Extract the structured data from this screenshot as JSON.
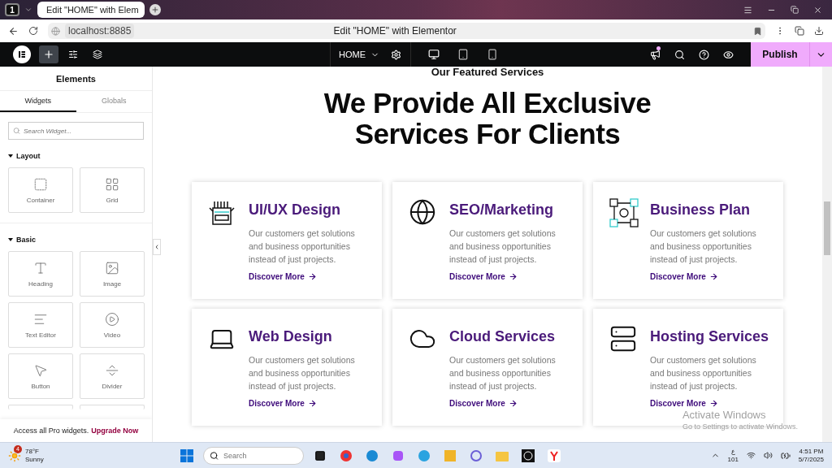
{
  "browser": {
    "tab_count": "1",
    "tab_title": "Edit \"HOME\" with Elem",
    "address": "localhost:8885",
    "page_title": "Edit \"HOME\" with Elementor"
  },
  "editor_toolbar": {
    "page_menu": "HOME",
    "devices": [
      {
        "kind": "desktop",
        "selected": true
      },
      {
        "kind": "tablet",
        "selected": false
      },
      {
        "kind": "mobile",
        "selected": false
      }
    ],
    "publish": "Publish",
    "has_notification": true
  },
  "sidebar": {
    "title": "Elements",
    "tabs": [
      {
        "label": "Widgets",
        "selected": true
      },
      {
        "label": "Globals",
        "selected": false
      }
    ],
    "search": {
      "placeholder": "Search Widget..."
    },
    "sections": [
      {
        "title": "Layout",
        "expanded": true,
        "widgets": [
          {
            "kind": "container",
            "label": "Container"
          },
          {
            "kind": "grid",
            "label": "Grid"
          }
        ]
      },
      {
        "title": "Basic",
        "expanded": true,
        "widgets": [
          {
            "kind": "heading",
            "label": "Heading"
          },
          {
            "kind": "image",
            "label": "Image"
          },
          {
            "kind": "text",
            "label": "Text Editor"
          },
          {
            "kind": "video",
            "label": "Video"
          },
          {
            "kind": "button",
            "label": "Button"
          },
          {
            "kind": "divider",
            "label": "Divider"
          },
          {
            "kind": "partial"
          },
          {
            "kind": "partial"
          }
        ]
      }
    ],
    "promo": {
      "text": "Access all Pro widgets.",
      "link": "Upgrade Now"
    }
  },
  "canvas": {
    "eyebrow": "Our Featured Services",
    "heading": "We Provide All Exclusive Services For Clients",
    "services": [
      {
        "kind": "uiux",
        "title": "UI/UX Design",
        "text": "Our customers get solutions and business opportunities instead of just projects.",
        "link": "Discover More"
      },
      {
        "kind": "seo",
        "title": "SEO/Marketing",
        "text": "Our customers get solutions and business opportunities instead of just projects.",
        "link": "Discover More"
      },
      {
        "kind": "plan",
        "title": "Business Plan",
        "text": "Our customers get solutions and business opportunities instead of just projects.",
        "link": "Discover More"
      },
      {
        "kind": "web",
        "title": "Web Design",
        "text": "Our customers get solutions and business opportunities instead of just projects.",
        "link": "Discover More"
      },
      {
        "kind": "cloud",
        "title": "Cloud Services",
        "text": "Our customers get solutions and business opportunities instead of just projects.",
        "link": "Discover More"
      },
      {
        "kind": "hosting",
        "title": "Hosting Services",
        "text": "Our customers get solutions and business opportunities instead of just projects.",
        "link": "Discover More"
      }
    ]
  },
  "activation_notice": {
    "title": "Activate Windows",
    "text": "Go to Settings to activate Windows."
  },
  "taskbar": {
    "weather": {
      "badge": "4",
      "temp": "78°F",
      "condition": "Sunny"
    },
    "search": {
      "placeholder": "Search"
    },
    "language": "ع",
    "language_code": "101",
    "time": "4:51 PM",
    "date": "5/7/2025"
  }
}
